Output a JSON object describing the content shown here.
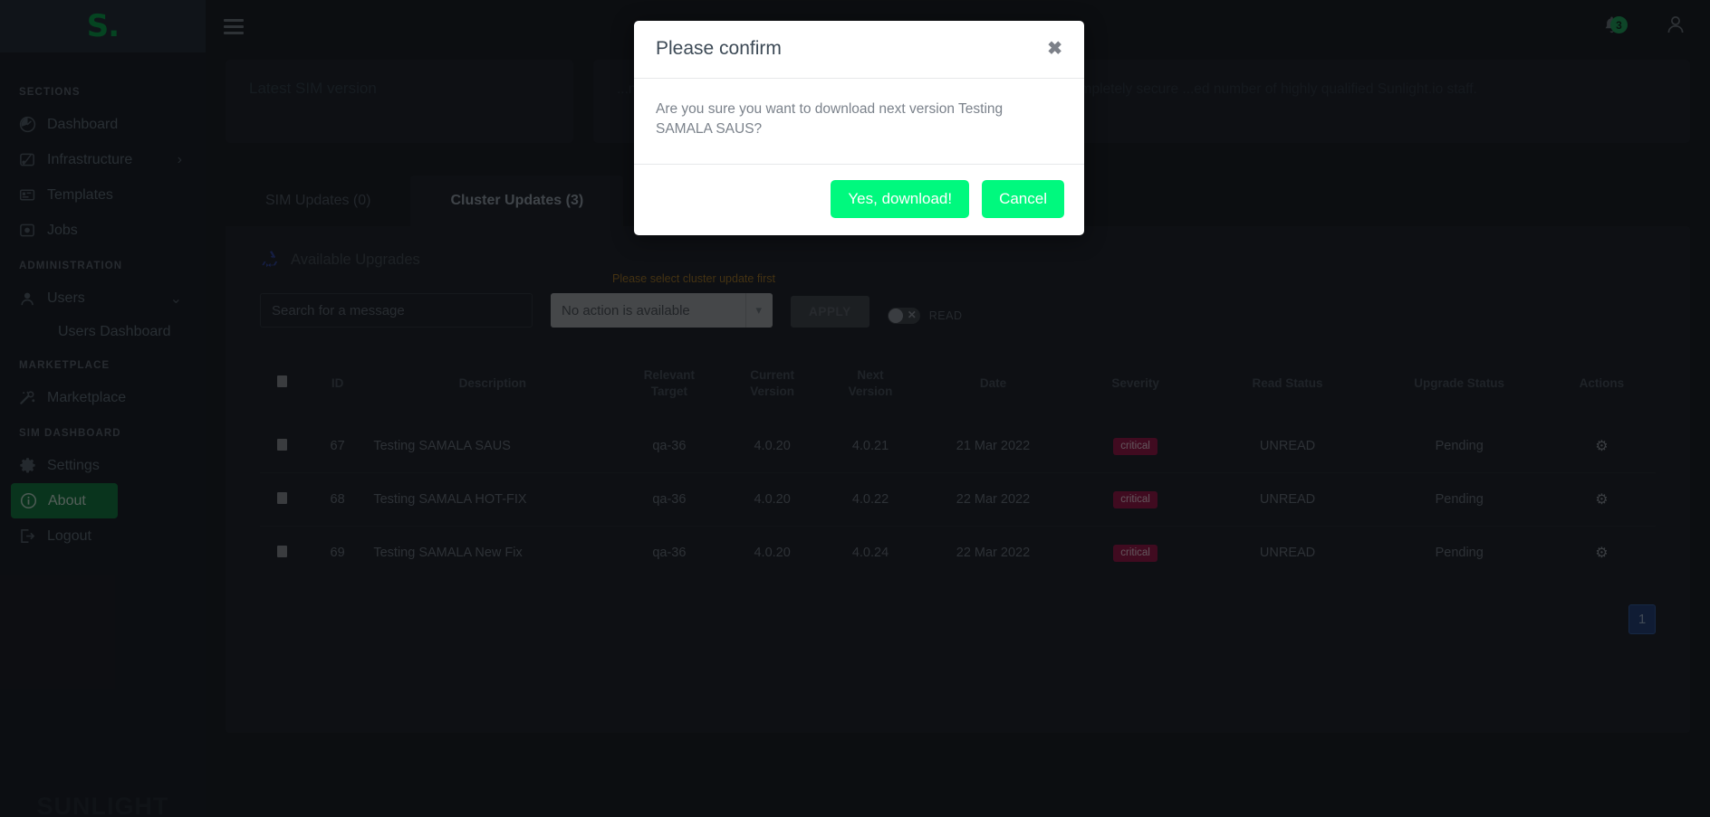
{
  "sidebar": {
    "logo": "S.",
    "footer_logo": "SUNLIGHT",
    "groups": [
      {
        "title": "SECTIONS",
        "items": [
          {
            "label": "Dashboard",
            "icon": "dashboard-icon"
          },
          {
            "label": "Infrastructure",
            "icon": "infrastructure-icon",
            "chevron": "›"
          },
          {
            "label": "Templates",
            "icon": "templates-icon"
          },
          {
            "label": "Jobs",
            "icon": "jobs-icon"
          }
        ]
      },
      {
        "title": "ADMINISTRATION",
        "items": [
          {
            "label": "Users",
            "icon": "users-icon",
            "chevron": "⌄"
          }
        ],
        "sub": [
          {
            "label": "Users Dashboard"
          }
        ]
      },
      {
        "title": "MARKETPLACE",
        "items": [
          {
            "label": "Marketplace",
            "icon": "marketplace-icon"
          }
        ]
      },
      {
        "title": "SIM DASHBOARD",
        "items": [
          {
            "label": "Settings",
            "icon": "gear-icon"
          },
          {
            "label": "About",
            "icon": "info-icon",
            "active": true
          },
          {
            "label": "Logout",
            "icon": "logout-icon"
          }
        ]
      }
    ]
  },
  "topbar": {
    "notification_count": "3",
    "bell_icon": "bell-icon",
    "avatar_icon": "user-avatar-icon",
    "menu_icon": "hamburger-menu-icon"
  },
  "cards": {
    "latest_sim_version_label": "Latest SIM version",
    "support_paragraph": "...ns enabled for the purposes of troubleshooting and assistance. This a completely secure ...ed number of highly qualified Sunlight.io staff."
  },
  "tabs": [
    {
      "label": "SIM Updates (0)",
      "active": false
    },
    {
      "label": "Cluster Updates (3)",
      "active": true
    }
  ],
  "panel": {
    "heading": "Available Upgrades",
    "heading_icon": "recycle-icon",
    "search_placeholder": "Search for a message",
    "search_value": "",
    "select_hint": "Please select cluster update first",
    "select_value": "No action is available",
    "apply_label": "APPLY",
    "toggle_label": "READ",
    "toggle_state": "off",
    "pagination": {
      "current": "1"
    }
  },
  "table": {
    "columns": [
      "",
      "ID",
      "Description",
      "Relevant\nTarget",
      "Current\nVersion",
      "Next\nVersion",
      "Date",
      "Severity",
      "Read Status",
      "Upgrade Status",
      "Actions"
    ],
    "columns_display": {
      "c0": "",
      "c1": "ID",
      "c2": "Description",
      "c3a": "Relevant",
      "c3b": "Target",
      "c4a": "Current",
      "c4b": "Version",
      "c5a": "Next",
      "c5b": "Version",
      "c6": "Date",
      "c7": "Severity",
      "c8": "Read Status",
      "c9": "Upgrade Status",
      "c10": "Actions"
    },
    "rows": [
      {
        "id": "67",
        "description": "Testing SAMALA SAUS",
        "target": "qa-36",
        "current_version": "4.0.20",
        "next_version": "4.0.21",
        "date": "21 Mar 2022",
        "severity": "critical",
        "read_status": "UNREAD",
        "upgrade_status": "Pending",
        "action_icon": "gear-icon"
      },
      {
        "id": "68",
        "description": "Testing SAMALA HOT-FIX",
        "target": "qa-36",
        "current_version": "4.0.20",
        "next_version": "4.0.22",
        "date": "22 Mar 2022",
        "severity": "critical",
        "read_status": "UNREAD",
        "upgrade_status": "Pending",
        "action_icon": "gear-icon"
      },
      {
        "id": "69",
        "description": "Testing SAMALA New Fix",
        "target": "qa-36",
        "current_version": "4.0.20",
        "next_version": "4.0.24",
        "date": "22 Mar 2022",
        "severity": "critical",
        "read_status": "UNREAD",
        "upgrade_status": "Pending",
        "action_icon": "gear-icon"
      }
    ]
  },
  "modal": {
    "title": "Please confirm",
    "close_icon": "close-icon",
    "message": "Are you sure you want to download next version Testing SAMALA SAUS?",
    "confirm_label": "Yes, download!",
    "cancel_label": "Cancel"
  },
  "colors": {
    "brand_green": "#00a344",
    "accent_green": "#00f97e",
    "severity_critical_bg": "#9b0f43",
    "hint_orange": "#a5741f",
    "page_active_blue": "#1d3b76"
  }
}
